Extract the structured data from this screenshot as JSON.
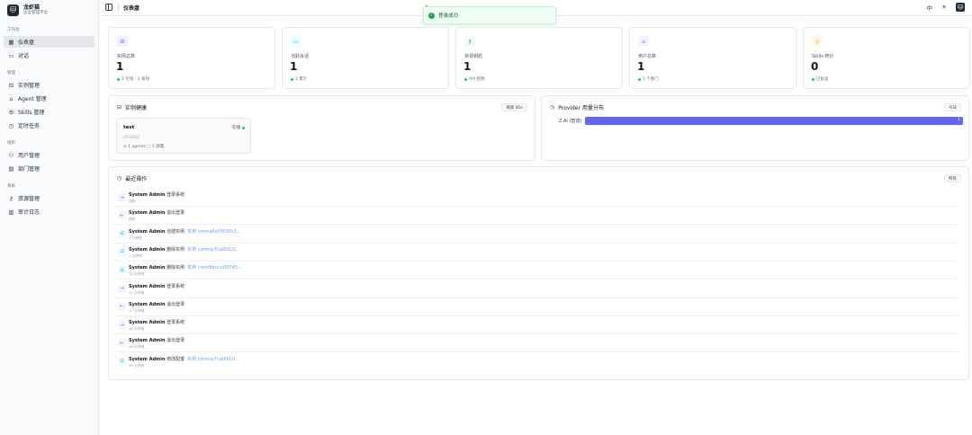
{
  "brand": {
    "logo": "🐱",
    "name": "龙虾猫",
    "subtitle": "企业管理平台"
  },
  "nav": {
    "sections": [
      {
        "label": "工作台",
        "items": [
          {
            "label": "仪表盘",
            "icon": "▦",
            "icon_name": "dashboard-icon",
            "active": true
          },
          {
            "label": "对话",
            "icon": "▭",
            "icon_name": "chat-icon",
            "active": false
          }
        ]
      },
      {
        "label": "管理",
        "items": [
          {
            "label": "实例管理",
            "icon": "⊟",
            "icon_name": "server-icon",
            "active": false
          },
          {
            "label": "Agent 管理",
            "icon": "⌂",
            "icon_name": "bot-icon",
            "active": false
          },
          {
            "label": "Skills 管理",
            "icon": "⚙",
            "icon_name": "plugin-icon",
            "active": false
          },
          {
            "label": "定时任务",
            "icon": "◷",
            "icon_name": "clock-icon",
            "active": false
          }
        ]
      },
      {
        "label": "组织",
        "items": [
          {
            "label": "用户管理",
            "icon": "⚇",
            "icon_name": "users-icon",
            "active": false
          },
          {
            "label": "部门管理",
            "icon": "▤",
            "icon_name": "building-icon",
            "active": false
          }
        ]
      },
      {
        "label": "系统",
        "items": [
          {
            "label": "资源管理",
            "icon": "⚷",
            "icon_name": "key-icon",
            "active": false
          },
          {
            "label": "审计日志",
            "icon": "▥",
            "icon_name": "log-icon",
            "active": false
          }
        ]
      }
    ]
  },
  "topbar": {
    "title": "仪表盘",
    "lang_icon": "中",
    "theme_icon": "☀",
    "avatar": "🐱"
  },
  "toast": {
    "message": "登录成功",
    "close": "×",
    "check": "✓"
  },
  "stats": [
    {
      "label": "实例总数",
      "value": "1",
      "sub": "1 在线 · 0 离线",
      "icon": "⊟",
      "icon_name": "server-icon",
      "icon_bg": "#eef2ff",
      "icon_color": "#6366f1",
      "dot_color": "#22c55e"
    },
    {
      "label": "活跃会话",
      "value": "1",
      "sub": "1 累计",
      "icon": "▭",
      "icon_name": "chat-icon",
      "icon_bg": "#ecfeff",
      "icon_color": "#06b6d4",
      "dot_color": "#22c55e"
    },
    {
      "label": "资源钥匙",
      "value": "1",
      "sub": "API 密钥",
      "icon": "⚷",
      "icon_name": "key-icon",
      "icon_bg": "#f0fdf4",
      "icon_color": "#16a34a",
      "dot_color": "#22c55e"
    },
    {
      "label": "用户总数",
      "value": "1",
      "sub": "1 个部门",
      "icon": "⌂",
      "icon_name": "user-icon",
      "icon_bg": "#f5f3ff",
      "icon_color": "#8b5cf6",
      "dot_color": "#22c55e"
    },
    {
      "label": "Skills 统计",
      "value": "0",
      "sub": "已批准",
      "icon": "◎",
      "icon_name": "skills-icon",
      "icon_bg": "#fefce8",
      "icon_color": "#eab308",
      "dot_color": "#22c55e"
    }
  ],
  "instances": {
    "title": "实例健康",
    "refresh": "刷新 85s",
    "items": [
      {
        "name": "test",
        "status": "在线",
        "id": "cl5181b7",
        "agents": "1 agents",
        "meta": "1 部署"
      }
    ]
  },
  "provider": {
    "title": "Provider 用量分布",
    "period": "今日",
    "chart_data": {
      "type": "bar",
      "categories": [
        "Z.AI (智谱)"
      ],
      "values": [
        1
      ]
    }
  },
  "operations": {
    "title": "最近操作",
    "all_label": "所有",
    "items": [
      {
        "user": "System Admin",
        "action": "登录系统",
        "target": "",
        "time": "刚刚",
        "icon": "⇥",
        "icon_name": "login-icon",
        "color": "#8b5cf6",
        "bg": "#f5f3ff"
      },
      {
        "user": "System Admin",
        "action": "退出登录",
        "target": "",
        "time": "刚刚",
        "icon": "⇤",
        "icon_name": "logout-icon",
        "color": "#8b5cf6",
        "bg": "#f5f3ff"
      },
      {
        "user": "System Admin",
        "action": "创建实例",
        "target": "实例 cmma8x09030r3...",
        "time": "3 分钟前",
        "icon": "⊟",
        "icon_name": "server-icon",
        "color": "#06b6d4",
        "bg": "#ecfeff"
      },
      {
        "user": "System Admin",
        "action": "删除实例",
        "target": "实例 cmmsy7ca0002f...",
        "time": "3 分钟前",
        "icon": "⊟",
        "icon_name": "server-icon",
        "color": "#06b6d4",
        "bg": "#ecfeff"
      },
      {
        "user": "System Admin",
        "action": "删除实例",
        "target": "实例 cmm8bucu007d0...",
        "time": "34 分钟前",
        "icon": "⊟",
        "icon_name": "server-icon",
        "color": "#06b6d4",
        "bg": "#ecfeff"
      },
      {
        "user": "System Admin",
        "action": "登录系统",
        "target": "",
        "time": "37 分钟前",
        "icon": "⇥",
        "icon_name": "login-icon",
        "color": "#8b5cf6",
        "bg": "#f5f3ff"
      },
      {
        "user": "System Admin",
        "action": "退出登录",
        "target": "",
        "time": "37 分钟前",
        "icon": "⇤",
        "icon_name": "logout-icon",
        "color": "#8b5cf6",
        "bg": "#f5f3ff"
      },
      {
        "user": "System Admin",
        "action": "登录系统",
        "target": "",
        "time": "48 分钟前",
        "icon": "⇥",
        "icon_name": "login-icon",
        "color": "#8b5cf6",
        "bg": "#f5f3ff"
      },
      {
        "user": "System Admin",
        "action": "退出登录",
        "target": "",
        "time": "48 分钟前",
        "icon": "⇤",
        "icon_name": "logout-icon",
        "color": "#8b5cf6",
        "bg": "#f5f3ff"
      },
      {
        "user": "System Admin",
        "action": "修改配置",
        "target": "实例 cmmsy7ca0002f...",
        "time": "49 分钟前",
        "icon": "⊟",
        "icon_name": "settings-icon",
        "color": "#06b6d4",
        "bg": "#ecfeff"
      }
    ]
  }
}
